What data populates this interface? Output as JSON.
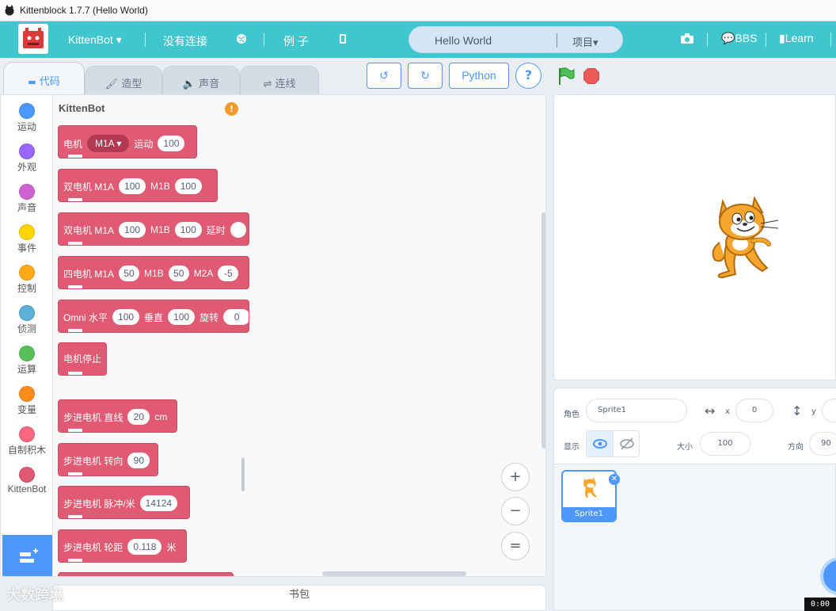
{
  "window": {
    "title": "Kittenblock 1.7.7 (Hello World)"
  },
  "menubar": {
    "board": "KittenBot",
    "connection": "没有连接",
    "examples": "例 子",
    "project_title": "Hello World",
    "project_menu": "项目",
    "bbs": "BBS",
    "learn": "Learn"
  },
  "tabs": {
    "code": "代码",
    "costumes": "造型",
    "sounds": "声音",
    "connect": "连线"
  },
  "toolbar": {
    "python": "Python",
    "help": "?"
  },
  "categories": [
    {
      "label": "运动",
      "color": "#4c97ff"
    },
    {
      "label": "外观",
      "color": "#9966ff"
    },
    {
      "label": "声音",
      "color": "#cf63cf"
    },
    {
      "label": "事件",
      "color": "#ffd500"
    },
    {
      "label": "控制",
      "color": "#ffab19"
    },
    {
      "label": "侦测",
      "color": "#5cb1d6"
    },
    {
      "label": "运算",
      "color": "#59c059"
    },
    {
      "label": "变量",
      "color": "#ff8c1a"
    },
    {
      "label": "自制积木",
      "color": "#ff6680"
    },
    {
      "label": "KittenBot",
      "color": "#df5a72"
    }
  ],
  "palette": {
    "title": "KittenBot",
    "warning": "!",
    "blocks": {
      "b1": {
        "t1": "电机",
        "dd": "M1A",
        "t2": "运动",
        "v1": "100"
      },
      "b2": {
        "t1": "双电机 M1A",
        "v1": "100",
        "t2": "M1B",
        "v2": "100"
      },
      "b3": {
        "t1": "双电机 M1A",
        "v1": "100",
        "t2": "M1B",
        "v2": "100",
        "t3": "延时"
      },
      "b4": {
        "t1": "四电机 M1A",
        "v1": "50",
        "t2": "M1B",
        "v2": "50",
        "t3": "M2A",
        "v3": "-5"
      },
      "b5": {
        "t1": "Omni 水平",
        "v1": "100",
        "t2": "垂直",
        "v2": "100",
        "t3": "旋转",
        "v3": "0"
      },
      "b6": {
        "t1": "电机停止"
      },
      "b7": {
        "t1": "步进电机 直线",
        "v1": "20",
        "t2": "cm"
      },
      "b8": {
        "t1": "步进电机 转向",
        "v1": "90"
      },
      "b9": {
        "t1": "步进电机 脉冲/米",
        "v1": "14124"
      },
      "b10": {
        "t1": "步进电机 轮距",
        "v1": "0.118",
        "t2": "米"
      }
    }
  },
  "zoom": {
    "in": "+",
    "out": "−",
    "reset": "="
  },
  "backpack": {
    "label": "书包"
  },
  "watermark": "大数跨境",
  "sprite_info": {
    "sprite_label": "角色",
    "sprite_name": "Sprite1",
    "x_label": "x",
    "x_value": "0",
    "y_label": "y",
    "show_label": "显示",
    "size_label": "大小",
    "size_value": "100",
    "direction_label": "方向",
    "direction_value": "90"
  },
  "sprites": [
    {
      "name": "Sprite1"
    }
  ],
  "clock": "0:00"
}
